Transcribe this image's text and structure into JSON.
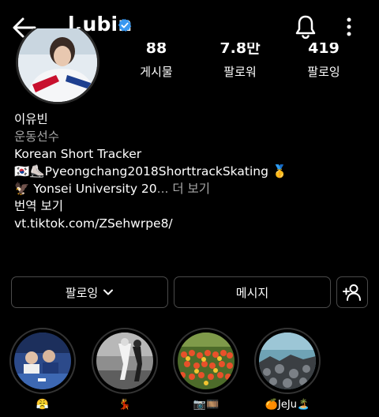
{
  "header": {
    "username": "l.ubin",
    "back_icon": "arrow-left-icon",
    "verified_icon": "verified-badge-icon",
    "bell_icon": "bell-icon",
    "more_icon": "vertical-ellipsis-icon"
  },
  "stats": [
    {
      "value": "88",
      "label": "게시물"
    },
    {
      "value": "7.8만",
      "label": "팔로워"
    },
    {
      "value": "419",
      "label": "팔로잉"
    }
  ],
  "bio": {
    "name": "이유빈",
    "category": "운동선수",
    "line1": "Korean Short Tracker",
    "line2_flag": "🇰🇷",
    "line2_skate": "⛸️",
    "line2_text": "Pyeongchang2018ShorttrackSkating",
    "line2_medal": "🥇",
    "line3_eagle": "🦅",
    "line3_text": " Yonsei University 20",
    "line3_more": "... 더 보기",
    "translate": "번역 보기",
    "link": "vt.tiktok.com/ZSehwrpe8/"
  },
  "buttons": {
    "following": "팔로잉",
    "message": "메시지",
    "add_user_icon": "add-user-icon"
  },
  "highlights": [
    {
      "caption": "😤"
    },
    {
      "caption": "💃"
    },
    {
      "caption": "📷🎞️"
    },
    {
      "caption": "🍊JeJu🏝️"
    }
  ],
  "colors": {
    "background": "#000000",
    "verified": "#3897f0",
    "muted_text": "#a8a8a8",
    "button_border": "#4a4a4a"
  }
}
